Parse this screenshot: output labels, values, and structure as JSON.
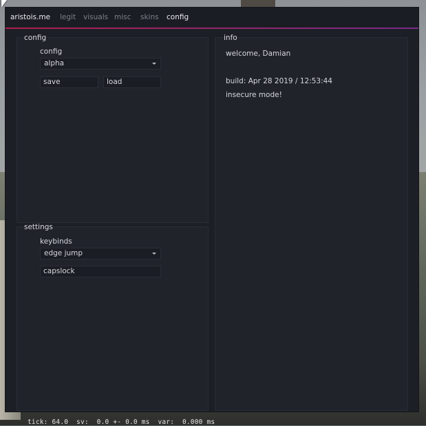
{
  "brand": "aristois.me",
  "tabs": [
    {
      "label": "legit",
      "active": false
    },
    {
      "label": "visuals",
      "active": false
    },
    {
      "label": "misc",
      "active": false
    },
    {
      "label": "skins",
      "active": false
    },
    {
      "label": "config",
      "active": true
    }
  ],
  "config_panel": {
    "title": "config",
    "section_label": "config",
    "dropdown_value": "alpha",
    "save_label": "save",
    "load_label": "load"
  },
  "settings_panel": {
    "title": "settings",
    "section_label": "keybinds",
    "dropdown_value": "edge jump",
    "key_value": "capslock"
  },
  "info_panel": {
    "title": "info",
    "welcome": "welcome, Damian",
    "build": "build: Apr 28 2019 / 12:53:44",
    "mode": "insecure mode!"
  },
  "netgraph": {
    "tick": "tick: 64.0",
    "sv": "sv:  0.0 +- 0.0 ms",
    "var": "var:  0.000 ms"
  },
  "colors": {
    "accent_start": "#b01f4c",
    "accent_end": "#7a2b8a",
    "window_bg": "#1d1f26",
    "panel_bg": "#21232b"
  },
  "icons": [
    "cursor-icon",
    "chevron-down-icon"
  ]
}
